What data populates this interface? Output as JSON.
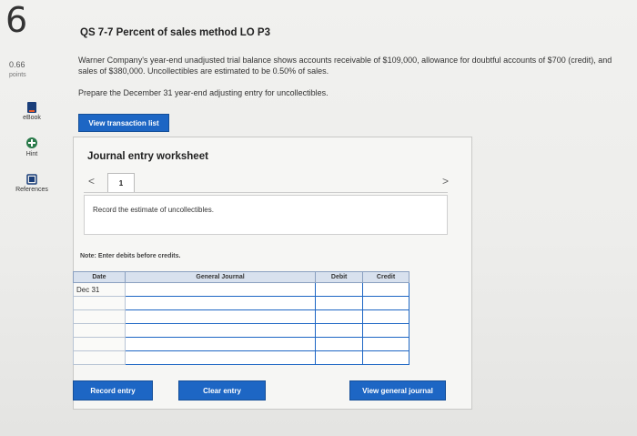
{
  "question": {
    "number": "6",
    "points_value": "0.66",
    "points_label": "points",
    "title": "QS 7-7 Percent of sales method LO P3",
    "text": "Warner Company's year-end unadjusted trial balance shows accounts receivable of $109,000, allowance for doubtful accounts of $700 (credit), and sales of $380,000. Uncollectibles are estimated to be 0.50% of sales.",
    "prepare": "Prepare the December 31 year-end adjusting entry for uncollectibles."
  },
  "sidebar": {
    "items": [
      {
        "label": "eBook",
        "icon": "book-icon"
      },
      {
        "label": "Hint",
        "icon": "hint-icon"
      },
      {
        "label": "References",
        "icon": "references-icon"
      }
    ]
  },
  "buttons": {
    "view_transaction_list": "View transaction list",
    "record_entry": "Record entry",
    "clear_entry": "Clear entry",
    "view_general_journal": "View general journal"
  },
  "worksheet": {
    "title": "Journal entry worksheet",
    "prev_arrow": "<",
    "next_arrow": ">",
    "tab_number": "1",
    "instruction": "Record the estimate of uncollectibles.",
    "note": "Note: Enter debits before credits."
  },
  "table": {
    "headers": [
      "Date",
      "General Journal",
      "Debit",
      "Credit"
    ],
    "rows": [
      [
        "Dec 31",
        "",
        "",
        ""
      ],
      [
        "",
        "",
        "",
        ""
      ],
      [
        "",
        "",
        "",
        ""
      ],
      [
        "",
        "",
        "",
        ""
      ],
      [
        "",
        "",
        "",
        ""
      ],
      [
        "",
        "",
        "",
        ""
      ]
    ]
  },
  "colors": {
    "accent": "#1d66c4",
    "header_bg": "#d8e1ee"
  }
}
